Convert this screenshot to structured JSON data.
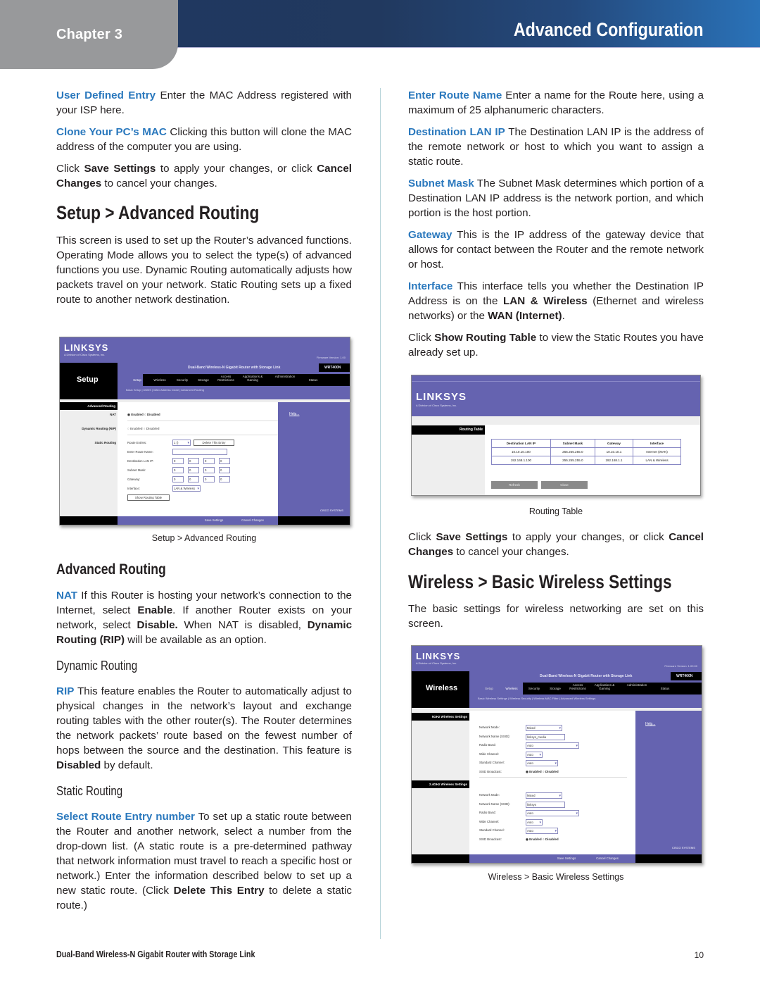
{
  "header": {
    "chapter": "Chapter 3",
    "title": "Advanced Configuration"
  },
  "left": {
    "p_user_defined": {
      "term": "User Defined Entry",
      "text": " Enter the MAC Address registered with your ISP here."
    },
    "p_clone": {
      "term": "Clone Your PC’s MAC",
      "text": " Clicking this button will clone the MAC address of the computer you are using."
    },
    "p_save": {
      "t1": "Click ",
      "b1": "Save Settings",
      "t2": " to apply your changes, or click ",
      "b2": "Cancel Changes",
      "t3": " to cancel your changes."
    },
    "h_setup_adv": "Setup > Advanced Routing",
    "p_intro": "This screen is used to set up the Router’s advanced functions. Operating Mode allows you to select the type(s) of advanced functions you use. Dynamic Routing automatically adjusts how packets travel on your network. Static Routing sets up a fixed route to another network destination.",
    "caption_adv": "Setup > Advanced Routing",
    "h_adv_routing": "Advanced Routing",
    "p_nat": {
      "term": "NAT",
      "t1": " If this Router is hosting your network’s connection to the Internet, select ",
      "b1": "Enable",
      "t2": ". If another Router exists on your network, select ",
      "b2": "Disable.",
      "t3": " When NAT is disabled, ",
      "b3": "Dynamic Routing (RIP)",
      "t4": " will be available as an option."
    },
    "h_dynamic": "Dynamic Routing",
    "p_rip": {
      "term": "RIP",
      "t1": " This feature enables the Router to automatically adjust to physical changes in the network’s layout and exchange routing tables with the other router(s). The Router determines the network packets’ route based on the fewest number of hops between the source and the destination. This feature is ",
      "b1": "Disabled",
      "t2": " by default."
    },
    "h_static": "Static Routing",
    "p_select_route": {
      "term": "Select Route Entry number",
      "t1": " To set up a static route between the Router and another network, select a number from the drop-down list. (A static route is a pre-determined pathway that network information must travel to reach a specific host or network.) Enter the information described below to set up a new static route. (Click ",
      "b1": "Delete This Entry",
      "t2": " to delete a static route.)"
    }
  },
  "right": {
    "p_route_name": {
      "term": "Enter Route Name",
      "text": " Enter a name for the Route here, using a maximum of 25 alphanumeric characters."
    },
    "p_dest_ip": {
      "term": "Destination LAN IP",
      "text": " The Destination LAN IP is the address of the remote network or host to which you want to assign a static route."
    },
    "p_subnet": {
      "term": "Subnet Mask",
      "text": " The Subnet Mask determines which portion of a Destination LAN IP address is the network portion, and which portion is the host portion."
    },
    "p_gateway": {
      "term": "Gateway",
      "text": " This is the IP address of the gateway device that allows for contact between the Router and the remote network or host."
    },
    "p_interface": {
      "term": "Interface",
      "t1": " This interface tells you whether the Destination IP Address is on the ",
      "b1": "LAN & Wireless",
      "t2": " (Ethernet and wireless networks) or the ",
      "b2": "WAN (Internet)",
      "t3": "."
    },
    "p_show_table": {
      "t1": "Click ",
      "b1": "Show Routing Table",
      "t2": " to view the Static Routes you have already set up."
    },
    "caption_rt": "Routing Table",
    "p_save": {
      "t1": "Click ",
      "b1": "Save Settings",
      "t2": " to apply your changes, or click ",
      "b2": "Cancel Changes",
      "t3": " to cancel your changes."
    },
    "h_wireless": "Wireless > Basic Wireless Settings",
    "p_wireless_intro": "The basic settings for wireless networking are set on this screen.",
    "caption_wireless": "Wireless > Basic Wireless Settings"
  },
  "shot_adv": {
    "logo": "LINKSYS",
    "logo_sub": "A Division of Cisco Systems, Inc.",
    "firmware": "Firmware Version: 1.00",
    "section": "Setup",
    "product": "Dual-Band Wireless-N Gigabit Router with Storage Link",
    "model": "WRT400N",
    "tabs": [
      "Setup",
      "Wireless",
      "Security",
      "Storage",
      "Access Restrictions",
      "Applications & Gaming",
      "Administration",
      "Status"
    ],
    "subnav": "Basic Setup  |  DDNS  |  MAC Address Clone  |  Advanced Routing",
    "side_header": "Advanced Routing",
    "nat_label": "NAT",
    "dyn_label": "Dynamic Routing (RIP)",
    "static_label": "Static Routing",
    "enabled": "Enabled",
    "disabled": "Disabled",
    "route_entries": "Route Entries:",
    "route_entry_value": "1 ()",
    "delete_entry": "Delete This Entry",
    "enter_route_name": "Enter Route Name:",
    "dest_lan_ip": "Destination LAN IP:",
    "subnet_mask": "Subnet Mask:",
    "gateway": "Gateway:",
    "interface": "Interface:",
    "interface_value": "LAN & Wireless",
    "octet": "0",
    "show_routing_table": "Show Routing Table",
    "help": "Help...",
    "save": "Save Settings",
    "cancel": "Cancel Changes",
    "cisco": "CISCO SYSTEMS"
  },
  "shot_rt": {
    "logo": "LINKSYS",
    "logo_sub": "A Division of Cisco Systems, Inc.",
    "side_header": "Routing Table",
    "columns": [
      "Destination LAN IP",
      "Subnet Mask",
      "Gateway",
      "Interface"
    ],
    "rows": [
      [
        "10.10.10.100",
        "255.255.255.0",
        "10.10.10.1",
        "Internet (WAN)"
      ],
      [
        "192.168.1.100",
        "255.255.255.0",
        "192.168.1.1",
        "LAN & Wireless"
      ]
    ],
    "refresh": "Refresh",
    "close": "Close"
  },
  "shot_wl": {
    "logo": "LINKSYS",
    "logo_sub": "A Division of Cisco Systems, Inc.",
    "firmware": "Firmware Version: 1.00.00",
    "section": "Wireless",
    "product": "Dual-Band Wireless-N Gigabit Router with Storage Link",
    "model": "WRT400N",
    "tabs": [
      "Setup",
      "Wireless",
      "Security",
      "Storage",
      "Access Restrictions",
      "Applications & Gaming",
      "Administration",
      "Status"
    ],
    "subnav": "Basic Wireless Settings  |  Wireless Security  |  Wireless MAC Filter  |  Advanced Wireless Settings",
    "band5_header": "5GHz Wireless Settings",
    "band24_header": "2.4GHz Wireless Settings",
    "labels": [
      "Network Mode:",
      "Network Name (SSID):",
      "Radio Band:",
      "Wide Channel:",
      "Standard Channel:",
      "SSID Broadcast:"
    ],
    "band5_values": {
      "mode": "Mixed",
      "ssid": "linksys_media",
      "radio_band": "Auto",
      "wide": "Auto",
      "standard": "Auto"
    },
    "band24_values": {
      "mode": "Mixed",
      "ssid": "linksys",
      "radio_band": "Auto",
      "wide": "Auto",
      "standard": "Auto"
    },
    "enabled": "Enabled",
    "disabled": "Disabled",
    "help": "Help...",
    "save": "Save Settings",
    "cancel": "Cancel Changes",
    "cisco": "CISCO SYSTEMS"
  },
  "footer": {
    "product": "Dual-Band Wireless-N Gigabit Router with Storage Link",
    "page": "10"
  }
}
